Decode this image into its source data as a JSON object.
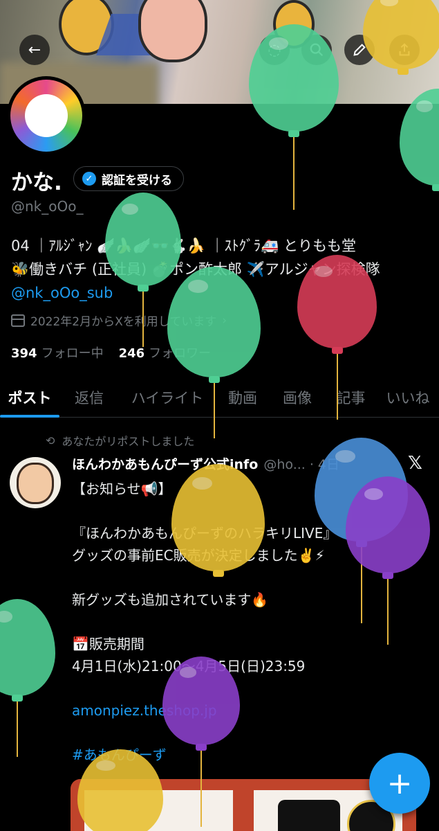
{
  "header": {
    "back_icon": "arrow-left-icon",
    "search_icon": "search-icon",
    "edit_icon": "pencil-icon",
    "share_icon": "share-icon"
  },
  "profile": {
    "name": "かな.",
    "verify_label": "認証を受ける",
    "handle": "@nk_oOo_",
    "bio_line1": "04 ｜ｱﾙｼﾞｬﾝ 🪽🍌🪽👓🐇🍌 ｜ｽﾄｸﾞﾗ🚑 とりもも堂",
    "bio_line2": "🐝働きバチ (正社員) 💣ポン酢太郎 ✈️アルジャン探検隊",
    "bio_link": "@nk_oOo_sub",
    "joined": "2022年2月からXを利用しています",
    "following_count": "394",
    "following_label": "フォロー中",
    "followers_count": "246",
    "followers_label": "フォロワー"
  },
  "tabs": [
    {
      "label": "ポスト",
      "active": true
    },
    {
      "label": "返信"
    },
    {
      "label": "ハイライト"
    },
    {
      "label": "動画"
    },
    {
      "label": "画像"
    },
    {
      "label": "記事"
    },
    {
      "label": "いいね"
    }
  ],
  "post": {
    "repost_label": "あなたがリポストしました",
    "author": "ほんわかあもんぴーず公式info",
    "handle_time": "@ho... · 4日",
    "lines": [
      "【お知らせ📢】",
      "",
      "『ほんわかあもんぴーずのハラキリLIVE』",
      "グッズの事前EC販売が決定しました✌️⚡",
      "",
      "新グッズも追加されています🔥",
      "",
      "📅販売期間",
      "4月1日(水)21:00〜4月5日(日)23:59",
      "",
      "amonpiez.theshop.jp",
      "",
      "#あもんぴーず"
    ]
  },
  "fab_label": "+",
  "colors": {
    "accent": "#1d9bf0",
    "balloon_green": "#4fcf94",
    "balloon_red": "#d63c57",
    "balloon_yellow": "#e8c034",
    "balloon_blue": "#4a90d9",
    "balloon_purple": "#8a3fc9"
  }
}
